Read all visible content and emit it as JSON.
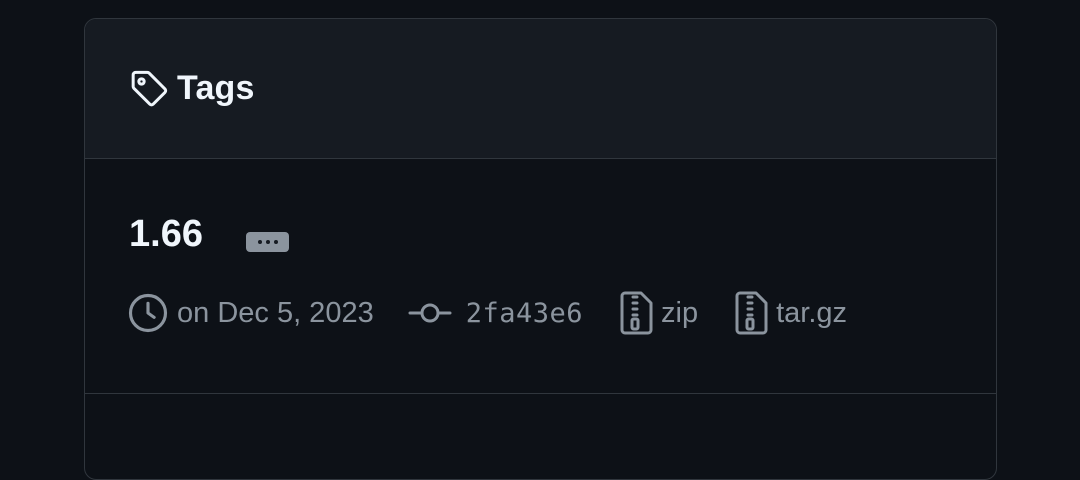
{
  "header": {
    "title": "Tags",
    "icon": "tag-icon"
  },
  "tags": [
    {
      "name": "1.66",
      "date_text": "on Dec 5, 2023",
      "commit": "2fa43e6",
      "zip_label": "zip",
      "targz_label": "tar.gz"
    }
  ],
  "colors": {
    "background": "#0d1117",
    "header_background": "#161b22",
    "border": "#30363d",
    "muted_text": "#8b949e",
    "primary_text": "#f0f6fc"
  }
}
